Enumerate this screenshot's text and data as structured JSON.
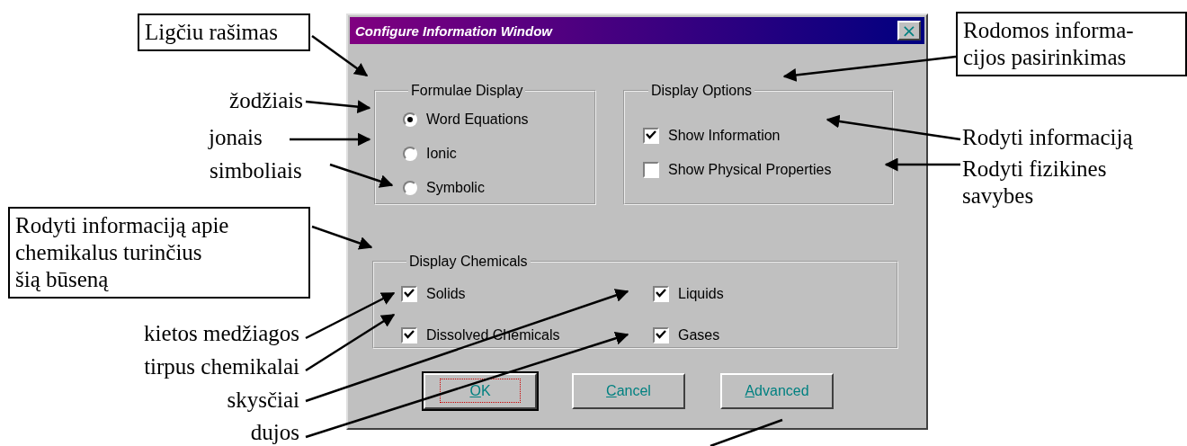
{
  "dialog": {
    "title": "Configure Information Window",
    "close": "×",
    "formulae_display": {
      "legend": "Formulae Display",
      "options": [
        {
          "label": "Word Equations",
          "selected": true
        },
        {
          "label": "Ionic",
          "selected": false
        },
        {
          "label": "Symbolic",
          "selected": false
        }
      ]
    },
    "display_options": {
      "legend": "Display Options",
      "items": [
        {
          "label": "Show Information",
          "checked": true
        },
        {
          "label": "Show Physical Properties",
          "checked": false
        }
      ]
    },
    "display_chemicals": {
      "legend": "Display Chemicals",
      "items": [
        {
          "label": "Solids",
          "checked": true
        },
        {
          "label": "Liquids",
          "checked": true
        },
        {
          "label": "Dissolved Chemicals",
          "checked": true
        },
        {
          "label": "Gases",
          "checked": true
        }
      ]
    },
    "buttons": [
      {
        "hotkey": "O",
        "rest": "K",
        "default": true
      },
      {
        "hotkey": "C",
        "rest": "ancel",
        "default": false
      },
      {
        "hotkey": "A",
        "rest": "dvanced",
        "default": false
      }
    ]
  },
  "callouts": [
    {
      "text": "Ligčiu rašimas",
      "boxed": true
    },
    {
      "text": "žodžiais",
      "boxed": false
    },
    {
      "text": "jonais",
      "boxed": false
    },
    {
      "text": "simboliais",
      "boxed": false
    },
    {
      "text": "Rodyti informaciją apie\nchemikalus turinčius\nšią būseną",
      "boxed": true
    },
    {
      "text": "kietos medžiagos",
      "boxed": false
    },
    {
      "text": "tirpus chemikalai",
      "boxed": false
    },
    {
      "text": "skysčiai",
      "boxed": false
    },
    {
      "text": "dujos",
      "boxed": false
    },
    {
      "text": "Rodomos informa-\ncijos pasirinkimas",
      "boxed": true
    },
    {
      "text": "Rodyti informaciją",
      "boxed": false
    },
    {
      "text": "Rodyti fizikines\n savybes",
      "boxed": false
    }
  ]
}
